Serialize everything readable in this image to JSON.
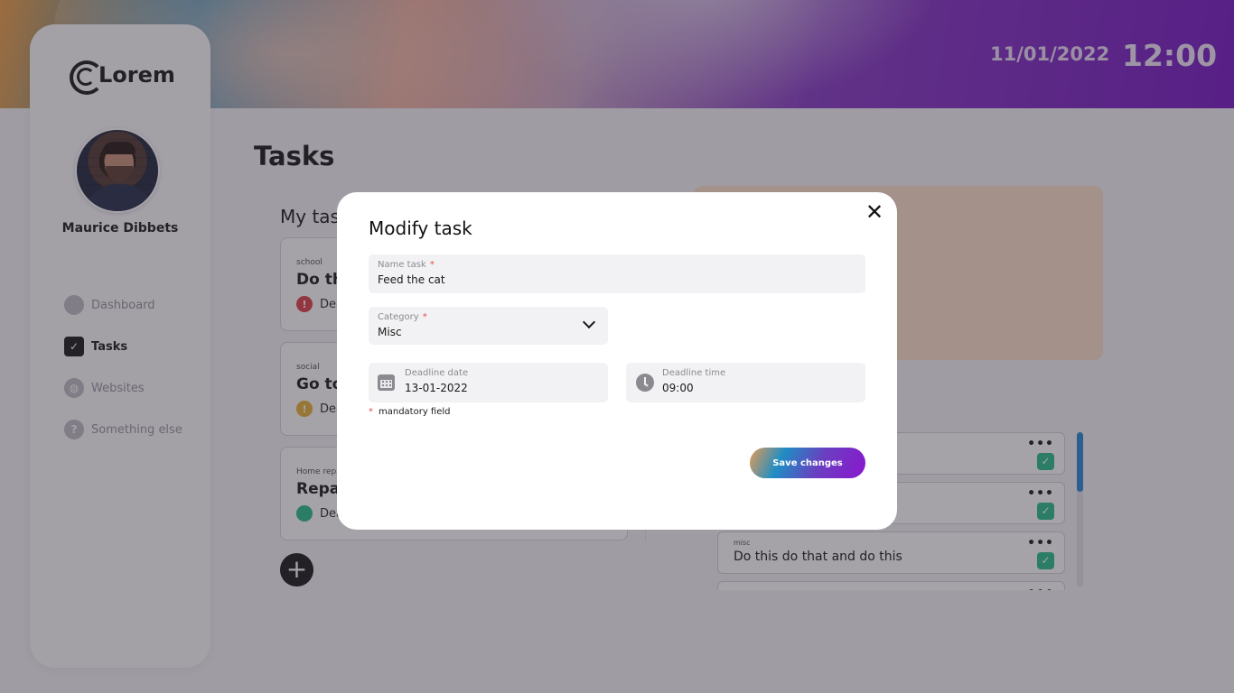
{
  "header": {
    "date": "11/01/2022",
    "time": "12:00"
  },
  "app": {
    "logo_text": "Lorem"
  },
  "user": {
    "name": "Maurice Dibbets"
  },
  "nav": [
    {
      "label": "Dashboard",
      "icon": "dashboard-icon",
      "active": false
    },
    {
      "label": "Tasks",
      "icon": "calendar-check-icon",
      "active": true
    },
    {
      "label": "Websites",
      "icon": "globe-icon",
      "active": false
    },
    {
      "label": "Something else",
      "icon": "question-icon",
      "active": false
    }
  ],
  "main": {
    "title": "Tasks",
    "section_title": "My tas",
    "tasks": [
      {
        "category": "school",
        "title": "Do thi",
        "status": "Dea",
        "status_color": "#e0454a",
        "status_icon": "!"
      },
      {
        "category": "social",
        "title": "Go to",
        "status": "Dea",
        "status_color": "#e8b43a",
        "status_icon": "!"
      },
      {
        "category": "Home repa",
        "title": "Repai",
        "status": "Dea",
        "status_color": "#2fbf8e",
        "status_icon": ""
      }
    ],
    "add_label": "+",
    "done_tasks": [
      {
        "category": "",
        "title": ""
      },
      {
        "category": "",
        "title": ""
      },
      {
        "category": "misc",
        "title": "Do this do that and do this"
      },
      {
        "category": "",
        "title": ""
      }
    ],
    "more_label": "•••",
    "check_label": "✓"
  },
  "modal": {
    "title": "Modify task",
    "close_label": "✕",
    "name_label": "Name task",
    "name_value": "Feed the cat",
    "category_label": "Category",
    "category_value": "Misc",
    "date_label": "Deadline date",
    "date_value": "13-01-2022",
    "time_label": "Deadline time",
    "time_value": "09:00",
    "required_mark": "*",
    "mandatory_text": "mandatory field",
    "save_label": "Save changes"
  },
  "colors": {
    "accent_blue": "#2b8cd6",
    "accent_purple": "#7a1fc4",
    "success": "#2fbf8e",
    "danger": "#e0454a",
    "warning": "#e8b43a"
  }
}
